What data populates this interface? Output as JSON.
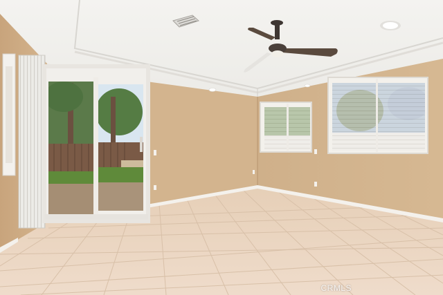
{
  "photo": {
    "watermark": "CRMLS"
  },
  "colors": {
    "wall": "#d2b38e",
    "wall_shadow": "#c4a07a",
    "ceiling": "#f2f1ee",
    "tray": "#ecebe8",
    "tile": "#ead6c3",
    "tile_grout": "#d7bfa8",
    "baseboard": "#f4f1ec",
    "blind": "#f3f1ec",
    "fan_blade": "#5a4a3e",
    "fence": "#7a5a46",
    "grass": "#5f8a3a",
    "sky": "#cfe0ee"
  },
  "objects": [
    "ceiling-fan-icon",
    "recessed-light-icon",
    "air-vent-icon",
    "sliding-glass-door",
    "vertical-blinds",
    "window-with-blinds",
    "wall-niche",
    "tile-floor"
  ]
}
